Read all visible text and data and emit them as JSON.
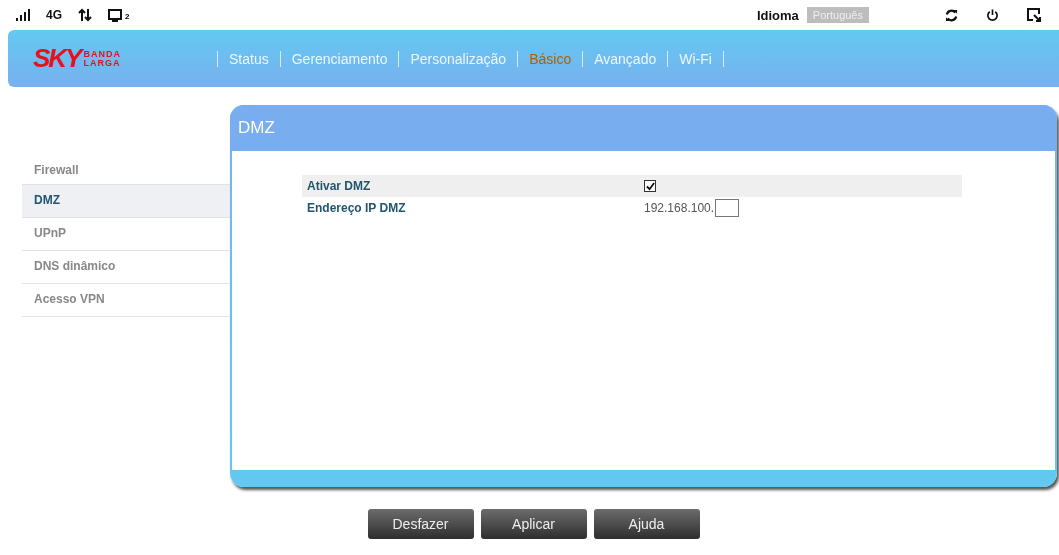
{
  "status_bar": {
    "network": "4G",
    "screen_count": "2",
    "language_label": "Idioma",
    "language": "Português"
  },
  "brand": {
    "sky": "SKY",
    "line1": "BANDA",
    "line2": "LARGA"
  },
  "nav": [
    {
      "label": "Status",
      "selected": false
    },
    {
      "label": "Gerenciamento",
      "selected": false
    },
    {
      "label": "Personalização",
      "selected": false
    },
    {
      "label": "Básico",
      "selected": true
    },
    {
      "label": "Avançado",
      "selected": false
    },
    {
      "label": "Wi-Fi",
      "selected": false
    }
  ],
  "sidebar": [
    {
      "label": "Firewall",
      "selected": false
    },
    {
      "label": "DMZ",
      "selected": true
    },
    {
      "label": "UPnP",
      "selected": false
    },
    {
      "label": "DNS dinâmico",
      "selected": false
    },
    {
      "label": "Acesso VPN",
      "selected": false
    }
  ],
  "panel": {
    "title": "DMZ",
    "enable_label": "Ativar DMZ",
    "enabled": true,
    "ip_label": "Endereço IP DMZ",
    "ip_prefix": "192.168.100."
  },
  "buttons": [
    "Desfazer",
    "Aplicar",
    "Ajuda"
  ]
}
